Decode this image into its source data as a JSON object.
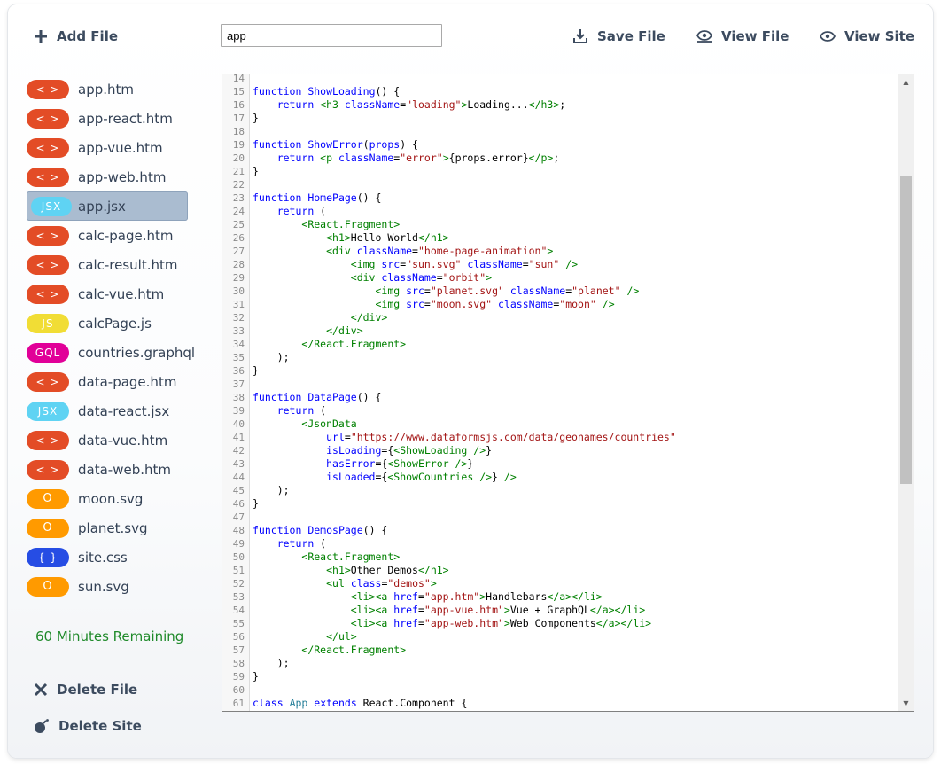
{
  "toolbar": {
    "add_file": "Add File",
    "save_file": "Save File",
    "view_file": "View File",
    "view_site": "View Site",
    "search_value": "app"
  },
  "sidebar": {
    "files": [
      {
        "badge": "< >",
        "name": "app.htm",
        "color": "#e34c26"
      },
      {
        "badge": "< >",
        "name": "app-react.htm",
        "color": "#e34c26"
      },
      {
        "badge": "< >",
        "name": "app-vue.htm",
        "color": "#e34c26"
      },
      {
        "badge": "< >",
        "name": "app-web.htm",
        "color": "#e34c26"
      },
      {
        "badge": "JSX",
        "name": "app.jsx",
        "color": "#5fd3f3",
        "active": true
      },
      {
        "badge": "< >",
        "name": "calc-page.htm",
        "color": "#e34c26"
      },
      {
        "badge": "< >",
        "name": "calc-result.htm",
        "color": "#e34c26"
      },
      {
        "badge": "< >",
        "name": "calc-vue.htm",
        "color": "#e34c26"
      },
      {
        "badge": "JS",
        "name": "calcPage.js",
        "color": "#f1dd35"
      },
      {
        "badge": "GQL",
        "name": "countries.graphql",
        "color": "#e10098"
      },
      {
        "badge": "< >",
        "name": "data-page.htm",
        "color": "#e34c26"
      },
      {
        "badge": "JSX",
        "name": "data-react.jsx",
        "color": "#5fd3f3"
      },
      {
        "badge": "< >",
        "name": "data-vue.htm",
        "color": "#e34c26"
      },
      {
        "badge": "< >",
        "name": "data-web.htm",
        "color": "#e34c26"
      },
      {
        "badge": "O",
        "name": "moon.svg",
        "color": "#ff9a00"
      },
      {
        "badge": "O",
        "name": "planet.svg",
        "color": "#ff9a00"
      },
      {
        "badge": "{ }",
        "name": "site.css",
        "color": "#264de4"
      },
      {
        "badge": "O",
        "name": "sun.svg",
        "color": "#ff9a00"
      }
    ],
    "remaining": "60 Minutes Remaining",
    "delete_file": "Delete File",
    "delete_site": "Delete Site"
  },
  "editor": {
    "lines": [
      {
        "n": "14",
        "html": ""
      },
      {
        "n": "15",
        "html": "<span class='kw'>function</span> <span class='fn'>ShowLoading</span>() {"
      },
      {
        "n": "16",
        "html": "    <span class='kw'>return</span> <span class='tag'>&lt;h3</span> <span class='attr'>className</span>=<span class='str'>\"loading\"</span><span class='tag'>&gt;</span>Loading...<span class='tag'>&lt;/h3&gt;</span>;"
      },
      {
        "n": "17",
        "html": "}"
      },
      {
        "n": "18",
        "html": ""
      },
      {
        "n": "19",
        "html": "<span class='kw'>function</span> <span class='fn'>ShowError</span>(<span class='attr'>props</span>) {"
      },
      {
        "n": "20",
        "html": "    <span class='kw'>return</span> <span class='tag'>&lt;p</span> <span class='attr'>className</span>=<span class='str'>\"error\"</span><span class='tag'>&gt;</span>{props.error}<span class='tag'>&lt;/p&gt;</span>;"
      },
      {
        "n": "21",
        "html": "}"
      },
      {
        "n": "22",
        "html": ""
      },
      {
        "n": "23",
        "html": "<span class='kw'>function</span> <span class='fn'>HomePage</span>() {"
      },
      {
        "n": "24",
        "html": "    <span class='kw'>return</span> ("
      },
      {
        "n": "25",
        "html": "        <span class='tag'>&lt;React.Fragment&gt;</span>"
      },
      {
        "n": "26",
        "html": "            <span class='tag'>&lt;h1&gt;</span>Hello World<span class='tag'>&lt;/h1&gt;</span>"
      },
      {
        "n": "27",
        "html": "            <span class='tag'>&lt;div</span> <span class='attr'>className</span>=<span class='str'>\"home-page-animation\"</span><span class='tag'>&gt;</span>"
      },
      {
        "n": "28",
        "html": "                <span class='tag'>&lt;img</span> <span class='attr'>src</span>=<span class='str'>\"sun.svg\"</span> <span class='attr'>className</span>=<span class='str'>\"sun\"</span> <span class='tag'>/&gt;</span>"
      },
      {
        "n": "29",
        "html": "                <span class='tag'>&lt;div</span> <span class='attr'>className</span>=<span class='str'>\"orbit\"</span><span class='tag'>&gt;</span>"
      },
      {
        "n": "30",
        "html": "                    <span class='tag'>&lt;img</span> <span class='attr'>src</span>=<span class='str'>\"planet.svg\"</span> <span class='attr'>className</span>=<span class='str'>\"planet\"</span> <span class='tag'>/&gt;</span>"
      },
      {
        "n": "31",
        "html": "                    <span class='tag'>&lt;img</span> <span class='attr'>src</span>=<span class='str'>\"moon.svg\"</span> <span class='attr'>className</span>=<span class='str'>\"moon\"</span> <span class='tag'>/&gt;</span>"
      },
      {
        "n": "32",
        "html": "                <span class='tag'>&lt;/div&gt;</span>"
      },
      {
        "n": "33",
        "html": "            <span class='tag'>&lt;/div&gt;</span>"
      },
      {
        "n": "34",
        "html": "        <span class='tag'>&lt;/React.Fragment&gt;</span>"
      },
      {
        "n": "35",
        "html": "    );"
      },
      {
        "n": "36",
        "html": "}"
      },
      {
        "n": "37",
        "html": ""
      },
      {
        "n": "38",
        "html": "<span class='kw'>function</span> <span class='fn'>DataPage</span>() {"
      },
      {
        "n": "39",
        "html": "    <span class='kw'>return</span> ("
      },
      {
        "n": "40",
        "html": "        <span class='tag'>&lt;JsonData</span>"
      },
      {
        "n": "41",
        "html": "            <span class='attr'>url</span>=<span class='str'>\"https://www.dataformsjs.com/data/geonames/countries\"</span>"
      },
      {
        "n": "42",
        "html": "            <span class='attr'>isLoading</span>={<span class='tag'>&lt;ShowLoading /&gt;</span>}"
      },
      {
        "n": "43",
        "html": "            <span class='attr'>hasError</span>={<span class='tag'>&lt;ShowError /&gt;</span>}"
      },
      {
        "n": "44",
        "html": "            <span class='attr'>isLoaded</span>={<span class='tag'>&lt;ShowCountries /&gt;</span>} <span class='tag'>/&gt;</span>"
      },
      {
        "n": "45",
        "html": "    );"
      },
      {
        "n": "46",
        "html": "}"
      },
      {
        "n": "47",
        "html": ""
      },
      {
        "n": "48",
        "html": "<span class='kw'>function</span> <span class='fn'>DemosPage</span>() {"
      },
      {
        "n": "49",
        "html": "    <span class='kw'>return</span> ("
      },
      {
        "n": "50",
        "html": "        <span class='tag'>&lt;React.Fragment&gt;</span>"
      },
      {
        "n": "51",
        "html": "            <span class='tag'>&lt;h1&gt;</span>Other Demos<span class='tag'>&lt;/h1&gt;</span>"
      },
      {
        "n": "52",
        "html": "            <span class='tag'>&lt;ul</span> <span class='attr'>class</span>=<span class='str'>\"demos\"</span><span class='tag'>&gt;</span>"
      },
      {
        "n": "53",
        "html": "                <span class='tag'>&lt;li&gt;&lt;a</span> <span class='attr'>href</span>=<span class='str'>\"app.htm\"</span><span class='tag'>&gt;</span>Handlebars<span class='tag'>&lt;/a&gt;&lt;/li&gt;</span>"
      },
      {
        "n": "54",
        "html": "                <span class='tag'>&lt;li&gt;&lt;a</span> <span class='attr'>href</span>=<span class='str'>\"app-vue.htm\"</span><span class='tag'>&gt;</span>Vue + GraphQL<span class='tag'>&lt;/a&gt;&lt;/li&gt;</span>"
      },
      {
        "n": "55",
        "html": "                <span class='tag'>&lt;li&gt;&lt;a</span> <span class='attr'>href</span>=<span class='str'>\"app-web.htm\"</span><span class='tag'>&gt;</span>Web Components<span class='tag'>&lt;/a&gt;&lt;/li&gt;</span>"
      },
      {
        "n": "56",
        "html": "            <span class='tag'>&lt;/ul&gt;</span>"
      },
      {
        "n": "57",
        "html": "        <span class='tag'>&lt;/React.Fragment&gt;</span>"
      },
      {
        "n": "58",
        "html": "    );"
      },
      {
        "n": "59",
        "html": "}"
      },
      {
        "n": "60",
        "html": ""
      },
      {
        "n": "61",
        "html": "<span class='kw'>class</span> <span class='name'>App</span> <span class='kw'>extends</span> React.Component {"
      }
    ]
  }
}
